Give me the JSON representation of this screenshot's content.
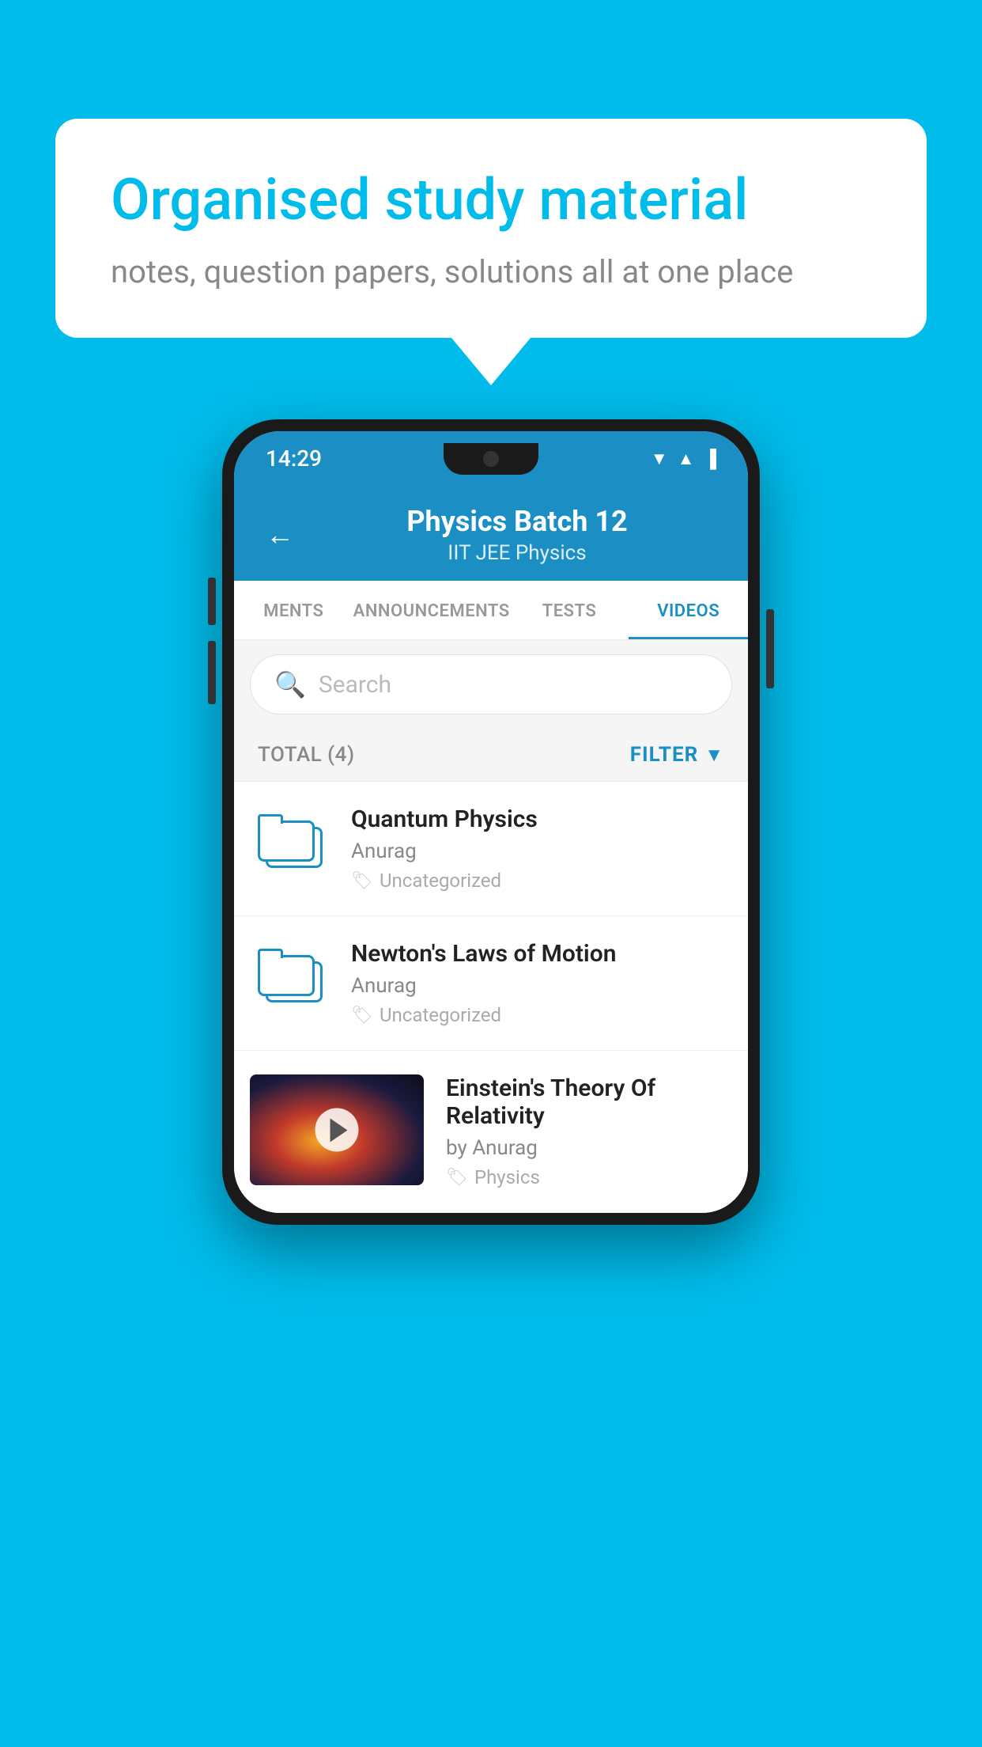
{
  "background_color": "#00BCEB",
  "speech_bubble": {
    "title": "Organised study material",
    "subtitle": "notes, question papers, solutions all at one place"
  },
  "status_bar": {
    "time": "14:29",
    "icons": [
      "wifi",
      "signal",
      "battery"
    ]
  },
  "app_header": {
    "back_label": "←",
    "title": "Physics Batch 12",
    "subtitle_part1": "IIT JEE",
    "subtitle_sep": "  ",
    "subtitle_part2": "Physics"
  },
  "tabs": [
    {
      "label": "MENTS",
      "active": false
    },
    {
      "label": "ANNOUNCEMENTS",
      "active": false
    },
    {
      "label": "TESTS",
      "active": false
    },
    {
      "label": "VIDEOS",
      "active": true
    }
  ],
  "search": {
    "placeholder": "Search"
  },
  "filter_row": {
    "total_label": "TOTAL (4)",
    "filter_label": "FILTER"
  },
  "videos": [
    {
      "title": "Quantum Physics",
      "author": "Anurag",
      "tag": "Uncategorized",
      "has_thumbnail": false
    },
    {
      "title": "Newton's Laws of Motion",
      "author": "Anurag",
      "tag": "Uncategorized",
      "has_thumbnail": false
    },
    {
      "title": "Einstein's Theory Of Relativity",
      "author": "by Anurag",
      "tag": "Physics",
      "has_thumbnail": true
    }
  ]
}
